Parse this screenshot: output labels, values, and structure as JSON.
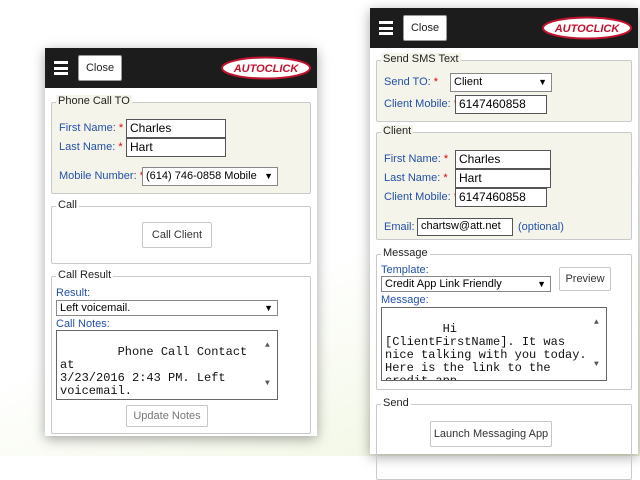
{
  "brand": {
    "logo_text": "AUTOCLICK",
    "accent": "#c4122f",
    "header_bg": "#1c1c1c",
    "label_color": "#2350a8"
  },
  "common": {
    "close_label": "Close",
    "menu_icon": "hamburger-icon"
  },
  "call_panel": {
    "phone_call_to": {
      "title": "Phone Call TO",
      "first_name_label": "First Name:",
      "first_name_value": "Charles",
      "last_name_label": "Last Name:",
      "last_name_value": "Hart",
      "mobile_label": "Mobile Number:",
      "mobile_value": "(614) 746-0858 Mobile"
    },
    "call": {
      "title": "Call",
      "call_button": "Call Client"
    },
    "call_result": {
      "title": "Call Result",
      "result_label": "Result:",
      "result_value": "Left voicemail.",
      "notes_label": "Call Notes:",
      "notes_value": "Phone Call Contact at\n3/23/2016 2:43 PM. Left\nvoicemail.",
      "update_button": "Update Notes"
    }
  },
  "sms_panel": {
    "send_sms": {
      "title": "Send SMS Text",
      "send_to_label": "Send TO:",
      "send_to_value": "Client",
      "client_mobile_label": "Client Mobile:",
      "client_mobile_value": "6147460858"
    },
    "client": {
      "title": "Client",
      "first_name_label": "First Name:",
      "first_name_value": "Charles",
      "last_name_label": "Last Name:",
      "last_name_value": "Hart",
      "client_mobile_label": "Client Mobile:",
      "client_mobile_value": "6147460858",
      "email_label": "Email:",
      "email_value": "chartsw@att.net",
      "optional_label": "(optional)"
    },
    "message": {
      "title": "Message",
      "template_label": "Template:",
      "template_value": "Credit App Link Friendly",
      "preview_button": "Preview",
      "message_label": "Message:",
      "message_value": "Hi [ClientFirstName]. It was\nnice talking with you today.\nHere is the link to the\ncredit app."
    },
    "send": {
      "title": "Send",
      "launch_button": "Launch Messaging App"
    }
  }
}
